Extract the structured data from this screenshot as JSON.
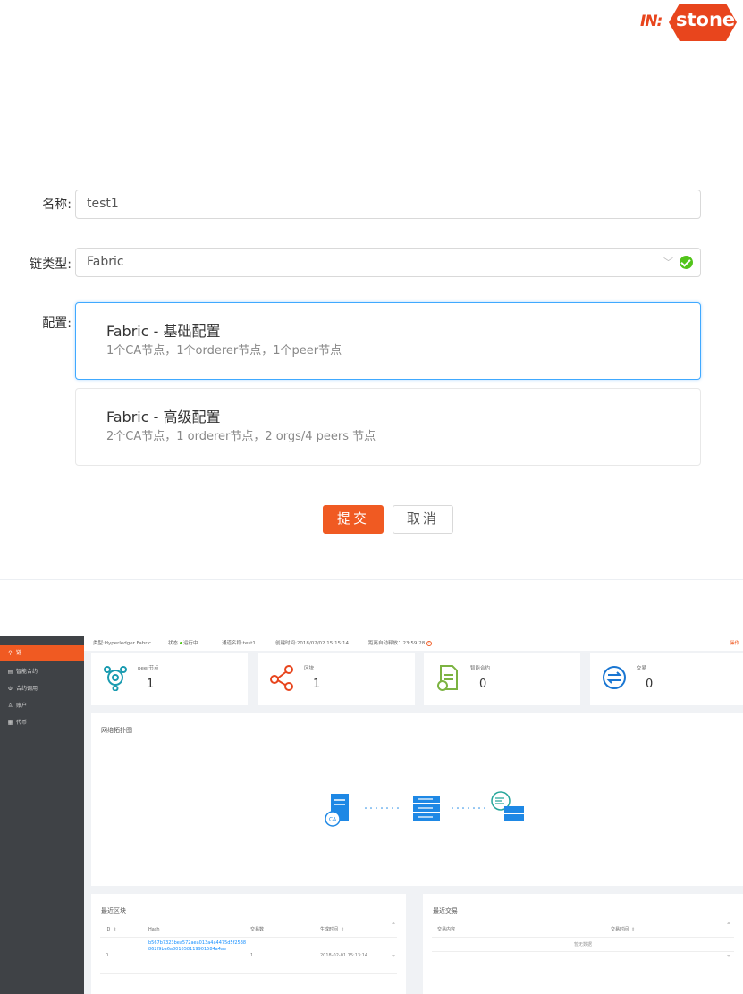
{
  "brand": {
    "prefix": "IN:",
    "name": "stone",
    "color": "#e8451d"
  },
  "form": {
    "name_label": "名称:",
    "name_value": "test1",
    "chain_type_label": "链类型:",
    "chain_type_value": "Fabric",
    "config_label": "配置:",
    "configs": [
      {
        "title": "Fabric - 基础配置",
        "desc": "1个CA节点，1个orderer节点，1个peer节点",
        "selected": true
      },
      {
        "title": "Fabric - 高级配置",
        "desc": "2个CA节点，1 orderer节点，2 orgs/4 peers 节点",
        "selected": false
      }
    ],
    "submit_label": "提交",
    "cancel_label": "取消"
  },
  "dashboard": {
    "sidebar": [
      {
        "label": "链",
        "icon": "link-icon",
        "active": true
      },
      {
        "label": "智能合约",
        "icon": "file-icon",
        "active": false
      },
      {
        "label": "合约调用",
        "icon": "code-icon",
        "active": false
      },
      {
        "label": "账户",
        "icon": "user-icon",
        "active": false
      },
      {
        "label": "代币",
        "icon": "token-icon",
        "active": false
      }
    ],
    "topbar": {
      "type": "类型:Hyperledger Fabric",
      "status_label": "状态",
      "status_value": "运行中",
      "channel": "通道名称:test1",
      "created": "创建时间:2018/02/02 15:15:14",
      "release": "距离自动释放：23:59:28",
      "operation": "操作"
    },
    "stats": [
      {
        "label": "peer节点",
        "value": "1",
        "icon": "peer-node-icon"
      },
      {
        "label": "区块",
        "value": "1",
        "icon": "block-icon"
      },
      {
        "label": "智能合约",
        "value": "0",
        "icon": "contract-icon"
      },
      {
        "label": "交易",
        "value": "0",
        "icon": "transaction-icon"
      }
    ],
    "topology": {
      "title": "网络拓扑图",
      "ca_label": "CA"
    },
    "recent_blocks": {
      "title": "最近区块",
      "columns": [
        "ID",
        "Hash",
        "交易数",
        "生成时间"
      ],
      "rows": [
        {
          "id": "0",
          "hash": "b567b7323bea572aea013a4a4475d5f2538862f9ba6a801658119901584a4ae",
          "tx_count": "1",
          "time": "2018-02-01 15:13:14"
        }
      ]
    },
    "recent_transactions": {
      "title": "最近交易",
      "columns": [
        "交易内容",
        "交易时间"
      ],
      "empty_text": "暂无数据"
    }
  },
  "colors": {
    "accent": "#f05a22",
    "icon_teal": "#1a9bb0",
    "icon_green": "#7cb342",
    "icon_blue": "#1976d2",
    "link": "#1890ff"
  }
}
